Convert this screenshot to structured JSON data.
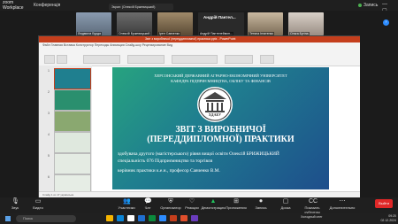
{
  "zoom": {
    "brand_line1": "zoom",
    "brand_line2": "Workplace",
    "conference_title": "Конференція",
    "recording_indicator": "Запись",
    "share_banner": "Экран: (Олексій Бржевицький)",
    "window_controls": "— ▢ ✕"
  },
  "participants": [
    {
      "name": "Людмила Бурда"
    },
    {
      "name": "Олексій Бржевицький"
    },
    {
      "name": "Ірен Савченко"
    },
    {
      "name": "Андрій Пантелеймон..."
    },
    {
      "name": "Тетяна Ігнатенко"
    },
    {
      "name": "Ольга Бугіна"
    }
  ],
  "participant_big_label": "Андрій Пантел...",
  "ppt": {
    "title_bar": "Звіт з виробничої (переддипломної) практики.pptx - PowerPoint",
    "tabs": "Файл   Главная   Вставка   Конструктор   Переходы   Анимация   Слайд-шоу   Рецензирование   Вид",
    "status": "Слайд 1 из 17   українська",
    "thumb_numbers": [
      "1",
      "2",
      "3",
      "4",
      "5",
      "6"
    ]
  },
  "slide": {
    "university": "ХЕРСОНСЬКИЙ ДЕРЖАВНИЙ АГРАРНО-ЕКОНОМІЧНИЙ УНІВЕРСИТЕТ",
    "department": "КАФЕДРА ПІДПРИЄМНИЦТВА, ОБЛІКУ ТА ФІНАНСІВ",
    "logo_text": "ХДАЕУ",
    "title_line1": "ЗВІТ З ВИРОБНИЧОЇ",
    "title_line2": "(ПЕРЕДДИПЛОМНОЇ) ПРАКТИКИ",
    "line1": "здобувача другого (магістерського) рівня вищої освіти Олексій БРИЖИЦЬКИЙ",
    "line2": "спеціальність 076 Підприємництво та торгівля",
    "line3": "керівник практики к.е.н., професор  Савченко В.М."
  },
  "toolbar": {
    "audio": "Звук",
    "video": "Видео",
    "participants": "Участники",
    "participants_count": "9",
    "chat": "Чат",
    "react": "Реакции",
    "share": "Демонстрация",
    "host_tools": "Организатор",
    "apps": "Приложения",
    "record": "Запись",
    "whiteboard": "Доска",
    "captions": "Показать субтитры",
    "more": "Дополнительно",
    "end": "Выйти"
  },
  "taskbar": {
    "search_placeholder": "Поиск",
    "weather": "Холодный снег",
    "language": "ENG",
    "time": "09:20",
    "date": "02.12.2024"
  }
}
